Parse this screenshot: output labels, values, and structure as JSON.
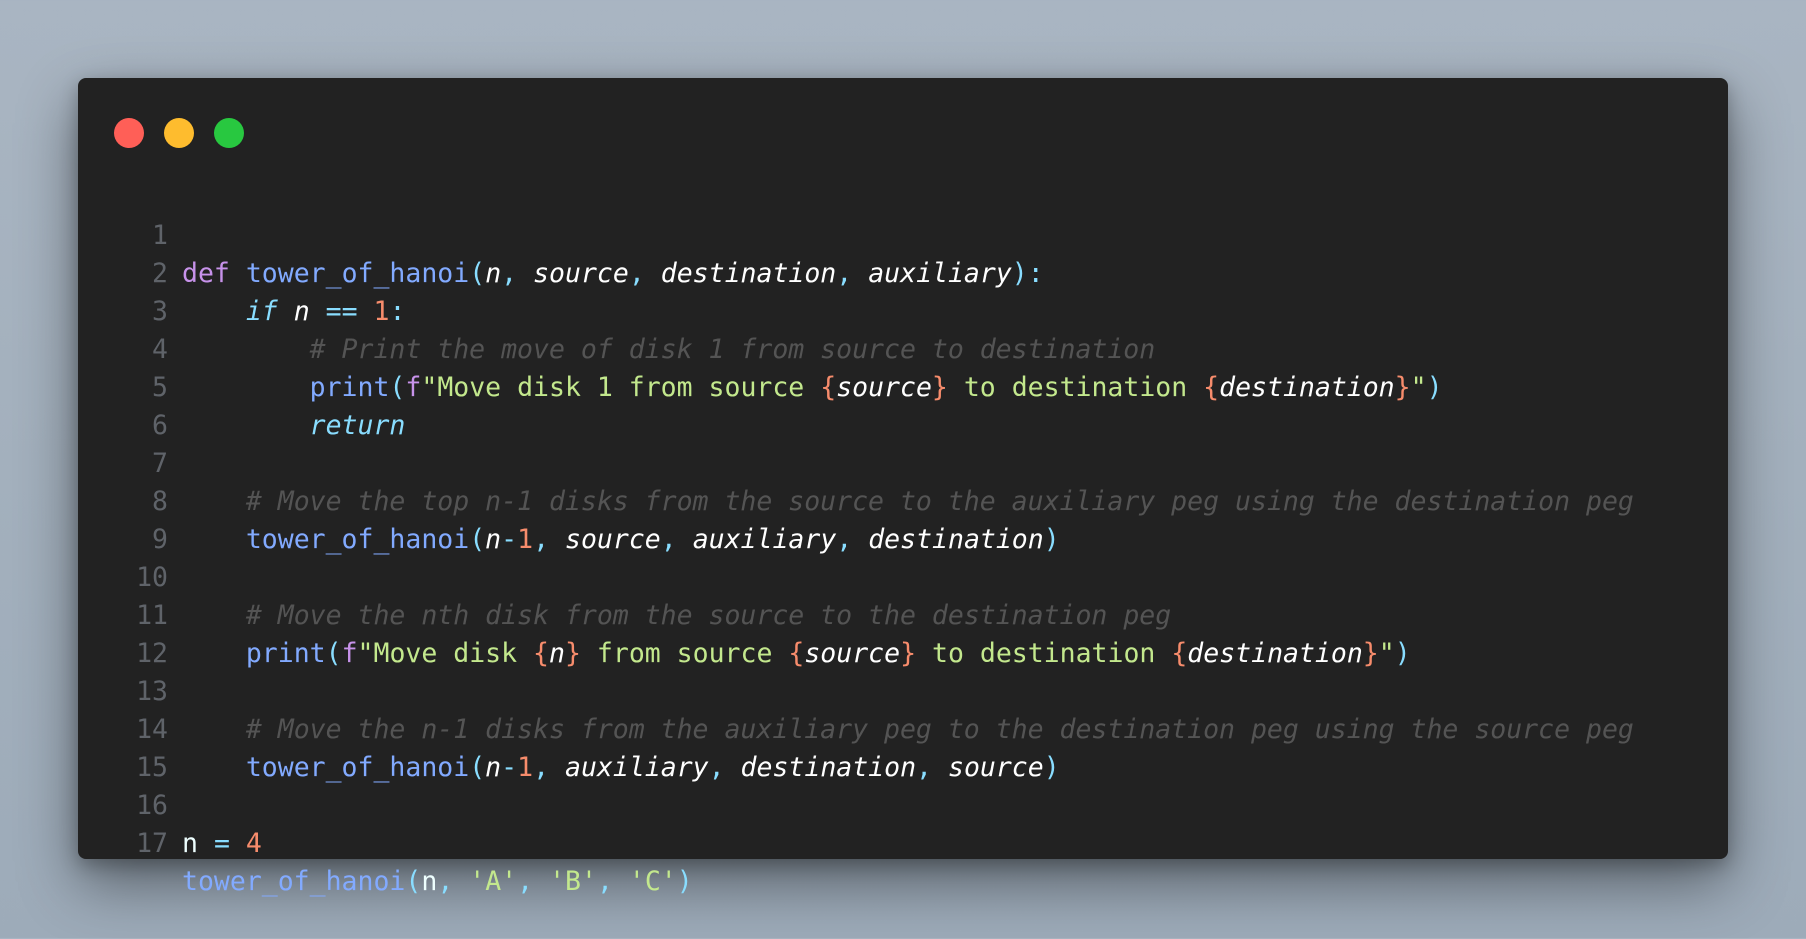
{
  "window": {
    "buttons": [
      "close",
      "minimize",
      "maximize"
    ],
    "colors": {
      "close": "#ff5f57",
      "minimize": "#febc2e",
      "maximize": "#28c840",
      "background": "#222222"
    }
  },
  "code": {
    "language": "python",
    "lines": [
      {
        "n": "1"
      },
      {
        "n": "2"
      },
      {
        "n": "3"
      },
      {
        "n": "4"
      },
      {
        "n": "5"
      },
      {
        "n": "6"
      },
      {
        "n": "7"
      },
      {
        "n": "8"
      },
      {
        "n": "9"
      },
      {
        "n": "10"
      },
      {
        "n": "11"
      },
      {
        "n": "12"
      },
      {
        "n": "13"
      },
      {
        "n": "14"
      },
      {
        "n": "15"
      },
      {
        "n": "16"
      },
      {
        "n": "17"
      }
    ],
    "tokens": {
      "def": "def",
      "fn": "tower_of_hanoi",
      "n": "n",
      "source": "source",
      "destination": "destination",
      "auxiliary": "auxiliary",
      "if": "if",
      "one": "1",
      "four": "4",
      "print": "print",
      "return": "return",
      "f": "f",
      "comment3": "# Print the move of disk 1 from source to destination",
      "str4a": "\"Move disk 1 from source ",
      "str4b": " to destination ",
      "comment7": "# Move the top n-1 disks from the source to the auxiliary peg using the destination peg",
      "comment10": "# Move the nth disk from the source to the destination peg",
      "str11a": "\"Move disk ",
      "str11b": " from source ",
      "str11c": " to destination ",
      "comment13": "# Move the n-1 disks from the auxiliary peg to the destination peg using the source peg",
      "argA": "'A'",
      "argB": "'B'",
      "argC": "'C'"
    }
  }
}
